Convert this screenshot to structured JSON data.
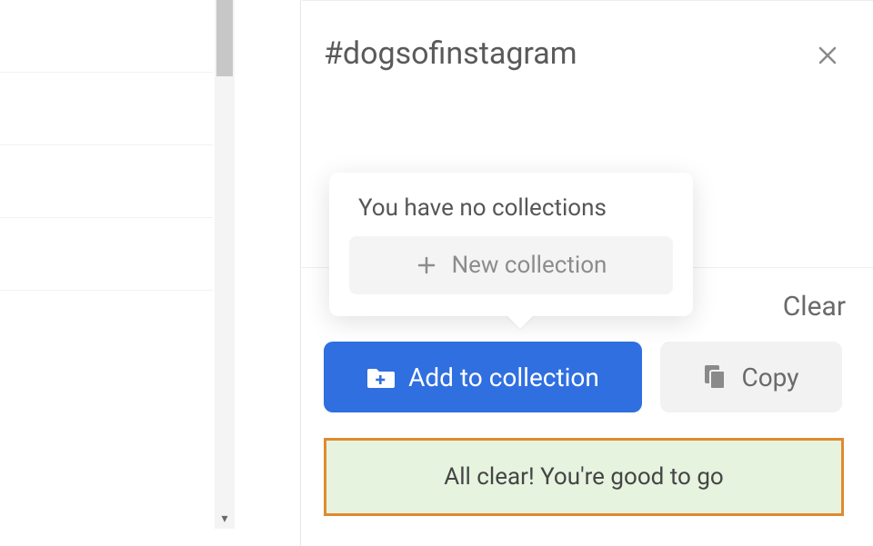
{
  "header": {
    "hashtag": "#dogsofinstagram"
  },
  "popover": {
    "title": "You have no collections",
    "new_collection_label": "New collection"
  },
  "actions": {
    "clear_label": "Clear",
    "add_to_collection_label": "Add to collection",
    "copy_label": "Copy"
  },
  "banner": {
    "message": "All clear! You're good to go"
  },
  "colors": {
    "primary": "#2f6fe0",
    "banner_border": "#e08a2f",
    "banner_bg": "#e6f3df"
  }
}
